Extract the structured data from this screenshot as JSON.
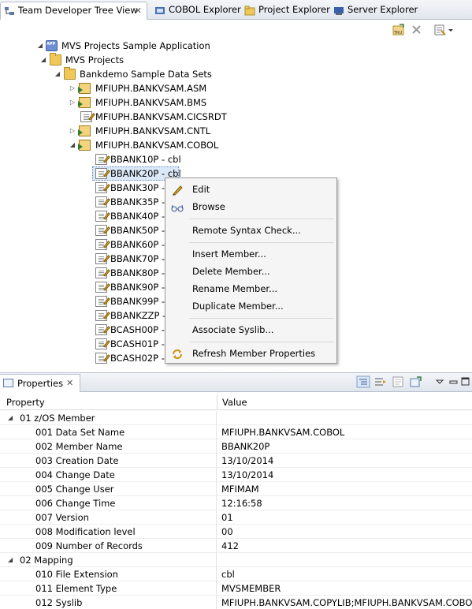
{
  "tabs": [
    {
      "label": "Team Developer Tree View",
      "icon": "tree-view-icon",
      "active": true
    },
    {
      "label": "COBOL Explorer",
      "icon": "cobol-explorer-icon"
    },
    {
      "label": "Project Explorer",
      "icon": "project-explorer-icon"
    },
    {
      "label": "Server Explorer",
      "icon": "server-explorer-icon"
    }
  ],
  "tree": {
    "root": "MVS Projects Sample Application",
    "projects": "MVS Projects",
    "group": "Bankdemo Sample Data Sets",
    "datasets": [
      "MFIUPH.BANKVSAM.ASM",
      "MFIUPH.BANKVSAM.BMS",
      "MFIUPH.BANKVSAM.CICSRDT",
      "MFIUPH.BANKVSAM.CNTL",
      "MFIUPH.BANKVSAM.COBOL"
    ],
    "members": [
      "BBANK10P - cbl",
      "BBANK20P - cbl",
      "BBANK30P -",
      "BBANK35P -",
      "BBANK40P -",
      "BBANK50P -",
      "BBANK60P -",
      "BBANK70P -",
      "BBANK80P -",
      "BBANK90P -",
      "BBANK99P -",
      "BBANKZZP -",
      "BCASH00P -",
      "BCASH01P -",
      "BCASH02P -"
    ]
  },
  "context_menu": {
    "edit": "Edit",
    "browse": "Browse",
    "remote_syntax_check": "Remote Syntax Check...",
    "insert_member": "Insert Member...",
    "delete_member": "Delete Member...",
    "rename_member": "Rename Member...",
    "duplicate_member": "Duplicate Member...",
    "associate_syslib": "Associate Syslib...",
    "refresh_member_properties": "Refresh Member Properties"
  },
  "properties": {
    "tab_label": "Properties",
    "header_property": "Property",
    "header_value": "Value",
    "rows": [
      {
        "name": "01 z/OS Member",
        "value": "",
        "group": true
      },
      {
        "name": "001 Data Set Name",
        "value": "MFIUPH.BANKVSAM.COBOL"
      },
      {
        "name": "002 Member Name",
        "value": "BBANK20P"
      },
      {
        "name": "003 Creation Date",
        "value": "13/10/2014"
      },
      {
        "name": "004 Change Date",
        "value": "13/10/2014"
      },
      {
        "name": "005 Change User",
        "value": "MFIMAM"
      },
      {
        "name": "006 Change Time",
        "value": "12:16:58"
      },
      {
        "name": "007 Version",
        "value": "01"
      },
      {
        "name": "008 Modification level",
        "value": "00"
      },
      {
        "name": "009 Number of Records",
        "value": "412"
      },
      {
        "name": "02 Mapping",
        "value": "",
        "group": true
      },
      {
        "name": "010 File Extension",
        "value": "cbl"
      },
      {
        "name": "011 Element Type",
        "value": "MVSMEMBER"
      },
      {
        "name": "012 Syslib",
        "value": "MFIUPH.BANKVSAM.COPYLIB;MFIUPH.BANKVSAM.COBOL"
      }
    ]
  }
}
